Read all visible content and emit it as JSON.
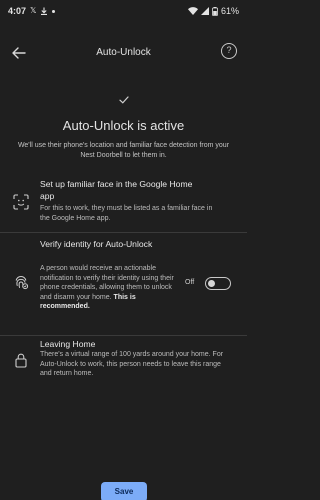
{
  "status_bar": {
    "time": "4:07",
    "battery": "61%"
  },
  "header": {
    "title": "Auto-Unlock",
    "help_label": "?"
  },
  "hero": {
    "headline": "Auto-Unlock is active",
    "description": "We'll use their phone's location and familiar face detection from your Nest Doorbell to let them in."
  },
  "rows": [
    {
      "title": "Set up familiar face in the Google Home app",
      "description": "For this to work, they must be listed as a familiar face in the Google Home app."
    },
    {
      "title": "Verify identity for Auto-Unlock",
      "description": "A person would receive an actionable notification to verify their identity using their phone credentials, allowing them to unlock and disarm your home.",
      "emphasis": "This is recommended.",
      "toggle_label": "Off",
      "toggle_on": false
    },
    {
      "title": "Leaving Home",
      "description": "There's a virtual range of 100 yards around your home. For Auto-Unlock to work, this person needs to leave this range and return home."
    }
  ],
  "footer": {
    "save_label": "Save"
  },
  "icons": {
    "back": "arrow-left-icon",
    "help": "help-circle-icon",
    "check": "checkmark-icon",
    "face": "face-scan-icon",
    "fingerprint": "fingerprint-icon",
    "lock": "lock-icon"
  },
  "colors": {
    "background": "#1f1f1f",
    "accent": "#7cacf8",
    "text": "#e3e3e3"
  }
}
